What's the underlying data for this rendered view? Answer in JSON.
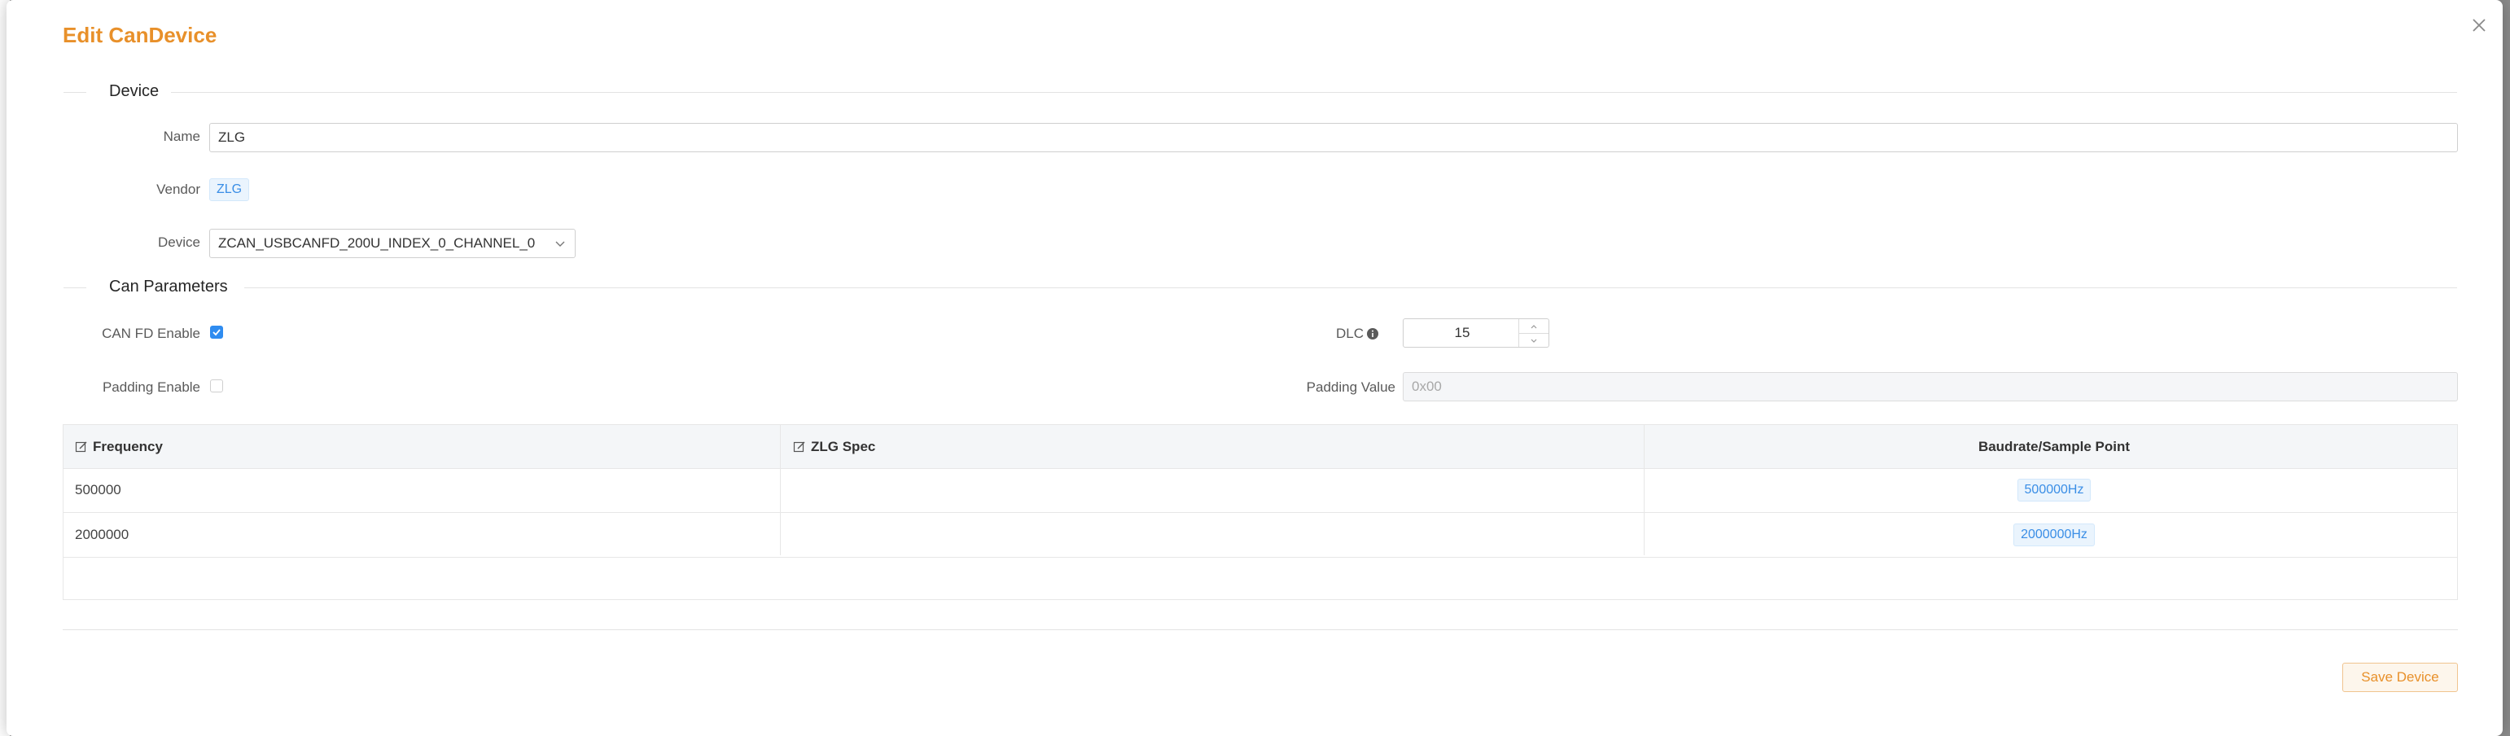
{
  "dialog": {
    "title": "Edit CanDevice",
    "save_label": "Save Device"
  },
  "sections": {
    "device": "Device",
    "can_parameters": "Can Parameters"
  },
  "device": {
    "name_label": "Name",
    "name_value": "ZLG",
    "vendor_label": "Vendor",
    "vendor_value": "ZLG",
    "device_label": "Device",
    "device_value": "ZCAN_USBCANFD_200U_INDEX_0_CHANNEL_0"
  },
  "can_params": {
    "canfd_label": "CAN FD Enable",
    "canfd_checked": true,
    "padding_label": "Padding Enable",
    "padding_checked": false,
    "dlc_label": "DLC",
    "dlc_value": "15",
    "padding_value_label": "Padding Value",
    "padding_value_placeholder": "0x00"
  },
  "table": {
    "headers": {
      "frequency": "Frequency",
      "spec": "ZLG Spec",
      "baudrate": "Baudrate/Sample Point"
    },
    "rows": [
      {
        "frequency": "500000",
        "spec": "",
        "baudrate": "500000Hz"
      },
      {
        "frequency": "2000000",
        "spec": "",
        "baudrate": "2000000Hz"
      }
    ]
  },
  "colors": {
    "accent": "#e8902a",
    "primary": "#2f8cf0",
    "tag_text": "#3a8ee6"
  },
  "icons": {
    "close": "close-icon",
    "chevron": "chevron-down-icon",
    "info": "info-icon",
    "edit": "edit-icon"
  }
}
